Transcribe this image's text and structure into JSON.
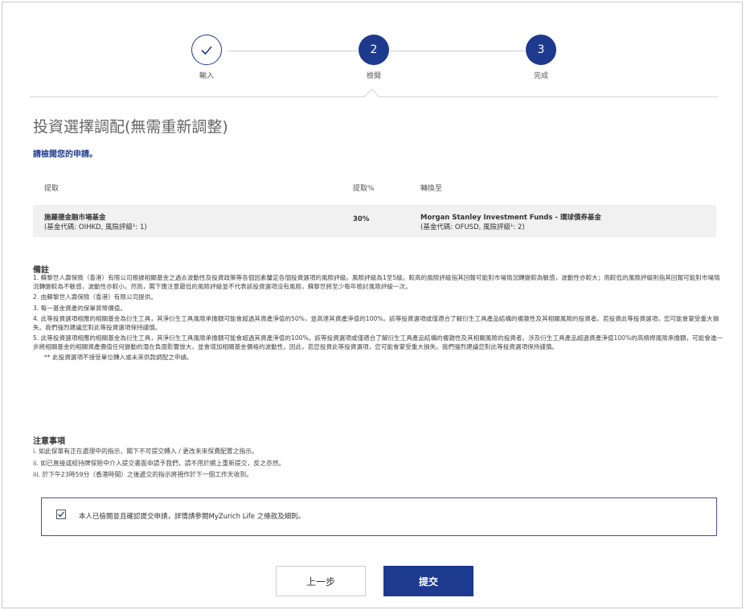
{
  "stepper": {
    "steps": [
      {
        "label": "輸入",
        "number": "",
        "state": "done"
      },
      {
        "label": "檢閱",
        "number": "2",
        "state": "active"
      },
      {
        "label": "完成",
        "number": "3",
        "state": "active"
      }
    ]
  },
  "page": {
    "title": "投資選擇調配(無需重新調整)",
    "subtitle": "請檢閱您的申請。"
  },
  "table": {
    "headers": [
      "提取",
      "提取%",
      "轉換至"
    ],
    "row": {
      "from_name": "施羅德金融市場基金",
      "from_detail": "(基金代碼: OIHKD, 風險評級¹: 1)",
      "percent": "30%",
      "to_name": "Morgan Stanley Investment Funds - 環球債券基金",
      "to_detail": "(基金代碼: OFUSD, 風險評級¹: 2)"
    }
  },
  "notes": {
    "heading": "備註",
    "items": [
      "1. 蘇黎世人壽保險（香港）有限公司根據相關基金之過去波動性及投資政策等各個因素釐定各個投資選項的風險評級。風險評級為1至5級。較高的風險評級指其回報可能對市場情況轉變較為敏感，波動性亦較大；而較低的風險評級則指其回報可能對市場情況轉變較為不敏感，波動性亦較小。然而，閣下應注意最低的風險評級並不代表該投資選項沒有風險，蘇黎世將至少每年檢討風險評級一次。",
      "2. 由蘇黎世人壽保險（香港）有限公司提供。",
      "3. 每一基金資產的保單貨幣價值。",
      "4. 此等投資選項相應的相關基金為衍生工具，其淨衍生工具風險承擔額可能會超過其資產淨值的50%，並高達其資產淨值的100%。該等投資選項或僅適合了解衍生工具產品結構的複雜性及其相關風險的投資者。若投資此等投資選項，您可能會蒙受重大損失。我們強烈建議您對此等投資選項保持謹慎。",
      "5. 此等投資選項相應的相關基金為衍生工具，其淨衍生工具風險承擔額可能會超過其資產淨值的100%。該等投資選項或僅適合了解衍生工具產品結構的複雜性及其相關風險的投資者。涉及衍生工具產品超過資產淨值100%的高槓桿風險承擔額，可能會進一步將相關基金的相關資產價值任何變動的潛在負面影響放大，並會增加相關基金價格的波動性。因此，若您投資此等投資選項，您可能會蒙受重大損失。我們強烈建議您對此等投資選項保持謹慎。"
    ],
    "extra": "** 此投資選項不接受單位轉入或未來供款調配之申請。"
  },
  "reminders": {
    "heading": "注意事項",
    "items": [
      "i. 如此保單有正在處理中的指示，閣下不可提交轉入 / 更改未來保費配置之指示。",
      "ii. 如已直接或經持牌保險中介人提交書面申請予我們，請不用於網上重新提交，反之亦然。",
      "iii. 於下午23時59分（香港時間）之後遞交的指示將視作於下一個工作天收到。"
    ]
  },
  "confirm": {
    "checked": true,
    "text": "本人已檢閱並且確認提交申請，詳情請參閱MyZurich Life 之條款及細則。"
  },
  "buttons": {
    "back": "上一步",
    "submit": "提交"
  },
  "colors": {
    "primary": "#1d3a8f",
    "row_bg": "#f1f1f1",
    "confirm_border": "#4b4ba8"
  }
}
